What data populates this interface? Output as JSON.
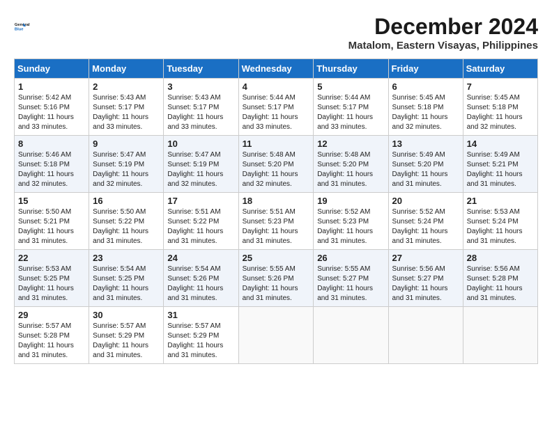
{
  "logo": {
    "line1": "General",
    "line2": "Blue"
  },
  "title": "December 2024",
  "subtitle": "Matalom, Eastern Visayas, Philippines",
  "days_of_week": [
    "Sunday",
    "Monday",
    "Tuesday",
    "Wednesday",
    "Thursday",
    "Friday",
    "Saturday"
  ],
  "weeks": [
    [
      {
        "day": "1",
        "info": "Sunrise: 5:42 AM\nSunset: 5:16 PM\nDaylight: 11 hours\nand 33 minutes."
      },
      {
        "day": "2",
        "info": "Sunrise: 5:43 AM\nSunset: 5:17 PM\nDaylight: 11 hours\nand 33 minutes."
      },
      {
        "day": "3",
        "info": "Sunrise: 5:43 AM\nSunset: 5:17 PM\nDaylight: 11 hours\nand 33 minutes."
      },
      {
        "day": "4",
        "info": "Sunrise: 5:44 AM\nSunset: 5:17 PM\nDaylight: 11 hours\nand 33 minutes."
      },
      {
        "day": "5",
        "info": "Sunrise: 5:44 AM\nSunset: 5:17 PM\nDaylight: 11 hours\nand 33 minutes."
      },
      {
        "day": "6",
        "info": "Sunrise: 5:45 AM\nSunset: 5:18 PM\nDaylight: 11 hours\nand 32 minutes."
      },
      {
        "day": "7",
        "info": "Sunrise: 5:45 AM\nSunset: 5:18 PM\nDaylight: 11 hours\nand 32 minutes."
      }
    ],
    [
      {
        "day": "8",
        "info": "Sunrise: 5:46 AM\nSunset: 5:18 PM\nDaylight: 11 hours\nand 32 minutes."
      },
      {
        "day": "9",
        "info": "Sunrise: 5:47 AM\nSunset: 5:19 PM\nDaylight: 11 hours\nand 32 minutes."
      },
      {
        "day": "10",
        "info": "Sunrise: 5:47 AM\nSunset: 5:19 PM\nDaylight: 11 hours\nand 32 minutes."
      },
      {
        "day": "11",
        "info": "Sunrise: 5:48 AM\nSunset: 5:20 PM\nDaylight: 11 hours\nand 32 minutes."
      },
      {
        "day": "12",
        "info": "Sunrise: 5:48 AM\nSunset: 5:20 PM\nDaylight: 11 hours\nand 31 minutes."
      },
      {
        "day": "13",
        "info": "Sunrise: 5:49 AM\nSunset: 5:20 PM\nDaylight: 11 hours\nand 31 minutes."
      },
      {
        "day": "14",
        "info": "Sunrise: 5:49 AM\nSunset: 5:21 PM\nDaylight: 11 hours\nand 31 minutes."
      }
    ],
    [
      {
        "day": "15",
        "info": "Sunrise: 5:50 AM\nSunset: 5:21 PM\nDaylight: 11 hours\nand 31 minutes."
      },
      {
        "day": "16",
        "info": "Sunrise: 5:50 AM\nSunset: 5:22 PM\nDaylight: 11 hours\nand 31 minutes."
      },
      {
        "day": "17",
        "info": "Sunrise: 5:51 AM\nSunset: 5:22 PM\nDaylight: 11 hours\nand 31 minutes."
      },
      {
        "day": "18",
        "info": "Sunrise: 5:51 AM\nSunset: 5:23 PM\nDaylight: 11 hours\nand 31 minutes."
      },
      {
        "day": "19",
        "info": "Sunrise: 5:52 AM\nSunset: 5:23 PM\nDaylight: 11 hours\nand 31 minutes."
      },
      {
        "day": "20",
        "info": "Sunrise: 5:52 AM\nSunset: 5:24 PM\nDaylight: 11 hours\nand 31 minutes."
      },
      {
        "day": "21",
        "info": "Sunrise: 5:53 AM\nSunset: 5:24 PM\nDaylight: 11 hours\nand 31 minutes."
      }
    ],
    [
      {
        "day": "22",
        "info": "Sunrise: 5:53 AM\nSunset: 5:25 PM\nDaylight: 11 hours\nand 31 minutes."
      },
      {
        "day": "23",
        "info": "Sunrise: 5:54 AM\nSunset: 5:25 PM\nDaylight: 11 hours\nand 31 minutes."
      },
      {
        "day": "24",
        "info": "Sunrise: 5:54 AM\nSunset: 5:26 PM\nDaylight: 11 hours\nand 31 minutes."
      },
      {
        "day": "25",
        "info": "Sunrise: 5:55 AM\nSunset: 5:26 PM\nDaylight: 11 hours\nand 31 minutes."
      },
      {
        "day": "26",
        "info": "Sunrise: 5:55 AM\nSunset: 5:27 PM\nDaylight: 11 hours\nand 31 minutes."
      },
      {
        "day": "27",
        "info": "Sunrise: 5:56 AM\nSunset: 5:27 PM\nDaylight: 11 hours\nand 31 minutes."
      },
      {
        "day": "28",
        "info": "Sunrise: 5:56 AM\nSunset: 5:28 PM\nDaylight: 11 hours\nand 31 minutes."
      }
    ],
    [
      {
        "day": "29",
        "info": "Sunrise: 5:57 AM\nSunset: 5:28 PM\nDaylight: 11 hours\nand 31 minutes."
      },
      {
        "day": "30",
        "info": "Sunrise: 5:57 AM\nSunset: 5:29 PM\nDaylight: 11 hours\nand 31 minutes."
      },
      {
        "day": "31",
        "info": "Sunrise: 5:57 AM\nSunset: 5:29 PM\nDaylight: 11 hours\nand 31 minutes."
      },
      {
        "day": "",
        "info": ""
      },
      {
        "day": "",
        "info": ""
      },
      {
        "day": "",
        "info": ""
      },
      {
        "day": "",
        "info": ""
      }
    ]
  ]
}
